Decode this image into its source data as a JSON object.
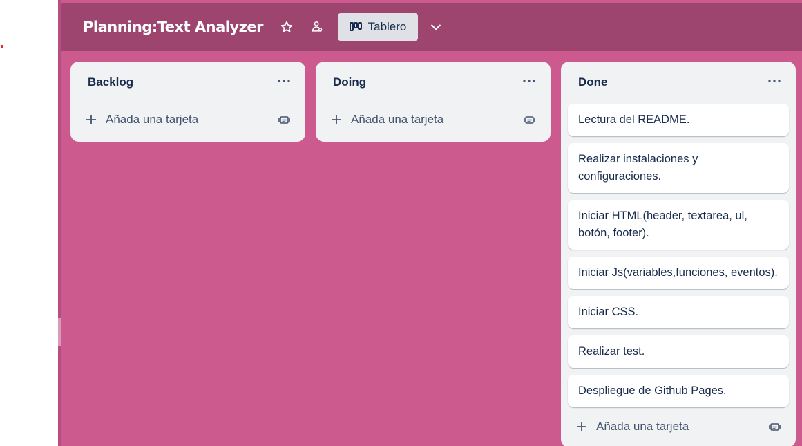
{
  "board": {
    "title": "Planning:Text Analyzer",
    "view_label": "Tablero",
    "background_color": "#cd5a8f",
    "header_color": "#9d456e"
  },
  "header_icons": [
    "star-icon",
    "visibility-icon",
    "board-view-icon",
    "chevron-down-icon"
  ],
  "lists": [
    {
      "title": "Backlog",
      "cards": [],
      "add_card_label": "Añada una tarjeta"
    },
    {
      "title": "Doing",
      "cards": [],
      "add_card_label": "Añada una tarjeta"
    },
    {
      "title": "Done",
      "cards": [
        "Lectura del README.",
        "Realizar instalaciones y configuraciones.",
        "Iniciar HTML(header, textarea, ul, botón, footer).",
        "Iniciar Js(variables,funciones, eventos).",
        "Iniciar CSS.",
        "Realizar test.",
        "Despliegue de Github Pages."
      ],
      "add_card_label": "Añada una tarjeta"
    }
  ]
}
